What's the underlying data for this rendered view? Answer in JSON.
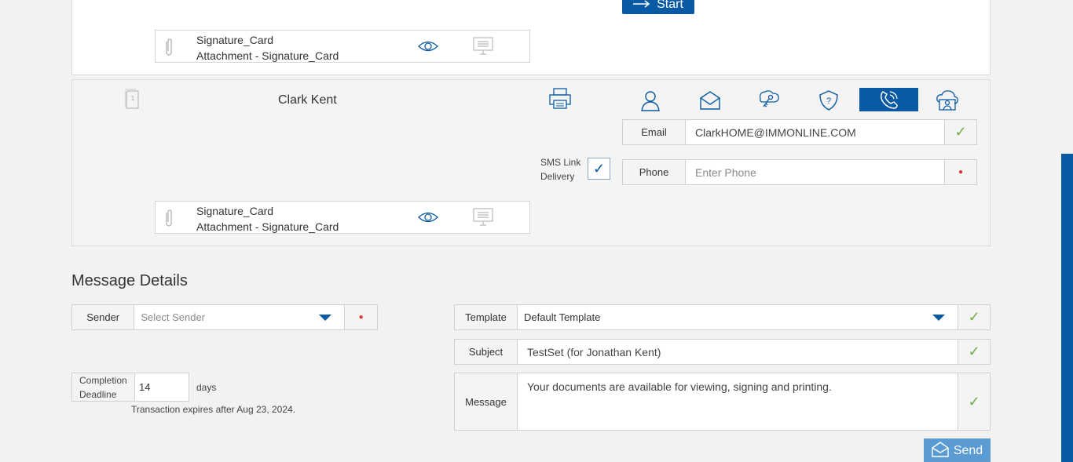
{
  "start_button": {
    "label": "Start"
  },
  "top_attachment": {
    "title": "Signature_Card",
    "subtitle": "Attachment - Signature_Card"
  },
  "signer": {
    "name": "Clark Kent",
    "email_label": "Email",
    "email_value": "ClarkHOME@IMMONLINE.COM",
    "phone_label": "Phone",
    "phone_placeholder": "Enter Phone",
    "sms_label_line1": "SMS Link",
    "sms_label_line2": "Delivery",
    "auth_icons": [
      "user-icon",
      "envelope-icon",
      "key-icon",
      "question-shield-icon",
      "phone-icon",
      "cloud-user-icon"
    ],
    "active_auth": "phone-icon",
    "attachment": {
      "title": "Signature_Card",
      "subtitle": "Attachment - Signature_Card"
    }
  },
  "message_details": {
    "title": "Message Details",
    "sender_label": "Sender",
    "sender_placeholder": "Select Sender",
    "template_label": "Template",
    "template_value": "Default Template",
    "subject_label": "Subject",
    "subject_value": "TestSet (for Jonathan Kent)",
    "message_label": "Message",
    "message_value": "Your documents are available for viewing, signing and printing.",
    "deadline_label_line1": "Completion",
    "deadline_label_line2": "Deadline",
    "deadline_value": "14",
    "days_label": "days",
    "expires_text": "Transaction expires after Aug 23, 2024.",
    "send_label": "Send"
  },
  "colors": {
    "primary": "#0a5aa3",
    "send": "#5a9bd4",
    "ok": "#6fae4a",
    "required": "#d33333"
  }
}
